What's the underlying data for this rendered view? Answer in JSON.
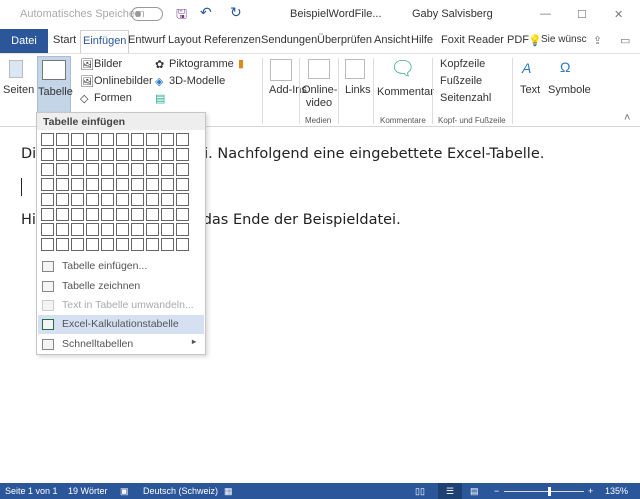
{
  "titlebar": {
    "autosave_label": "Automatisches Speichern",
    "doc_title": "BeispielWordFile...",
    "user": "Gaby Salvisberg",
    "minimize": "—",
    "maximize": "☐",
    "close": "✕"
  },
  "tabs": {
    "file": "Datei",
    "items": [
      "Start",
      "Einfügen",
      "Entwurf",
      "Layout",
      "Referenzen",
      "Sendungen",
      "Überprüfen",
      "Ansicht",
      "Hilfe",
      "Foxit Reader PDF"
    ],
    "tell_me": "Sie wünsc"
  },
  "ribbon": {
    "seiten": "Seiten",
    "tabelle": "Tabelle",
    "bilder": "Bilder",
    "onlinebilder": "Onlinebilder",
    "formen": "Formen",
    "piktogramme": "Piktogramme",
    "modelle": "3D-Modelle",
    "addins": "Add-Ins",
    "onlinevideo": "Online-video",
    "medien": "Medien",
    "links": "Links",
    "kommentar": "Kommentar",
    "kommentare": "Kommentare",
    "kopfzeile": "Kopfzeile",
    "fusszeile": "Fußzeile",
    "seitenzahl": "Seitenzahl",
    "kopf_fuss": "Kopf- und Fußzeile",
    "text": "Text",
    "symbole": "Symbole"
  },
  "document": {
    "line1": "Dies ist eine Beispieldatei. Nachfolgend eine eingebettete Excel-Tabelle.",
    "line2": "Hier ist der Text. Dies ist das Ende der Beispieldatei."
  },
  "menu": {
    "header": "Tabelle einfügen",
    "grid_cols": 10,
    "grid_rows": 8,
    "items": [
      {
        "label": "Tabelle einfügen...",
        "state": "normal"
      },
      {
        "label": "Tabelle zeichnen",
        "state": "normal"
      },
      {
        "label": "Text in Tabelle umwandeln...",
        "state": "disabled"
      },
      {
        "label": "Excel-Kalkulationstabelle",
        "state": "highlighted"
      },
      {
        "label": "Schnelltabellen",
        "state": "submenu"
      }
    ]
  },
  "status": {
    "page": "Seite 1 von 1",
    "words": "19 Wörter",
    "language": "Deutsch (Schweiz)",
    "zoom": "135%",
    "zoom_value": 135
  },
  "colors": {
    "accent": "#2b579a",
    "highlight": "#d5e1f2"
  }
}
